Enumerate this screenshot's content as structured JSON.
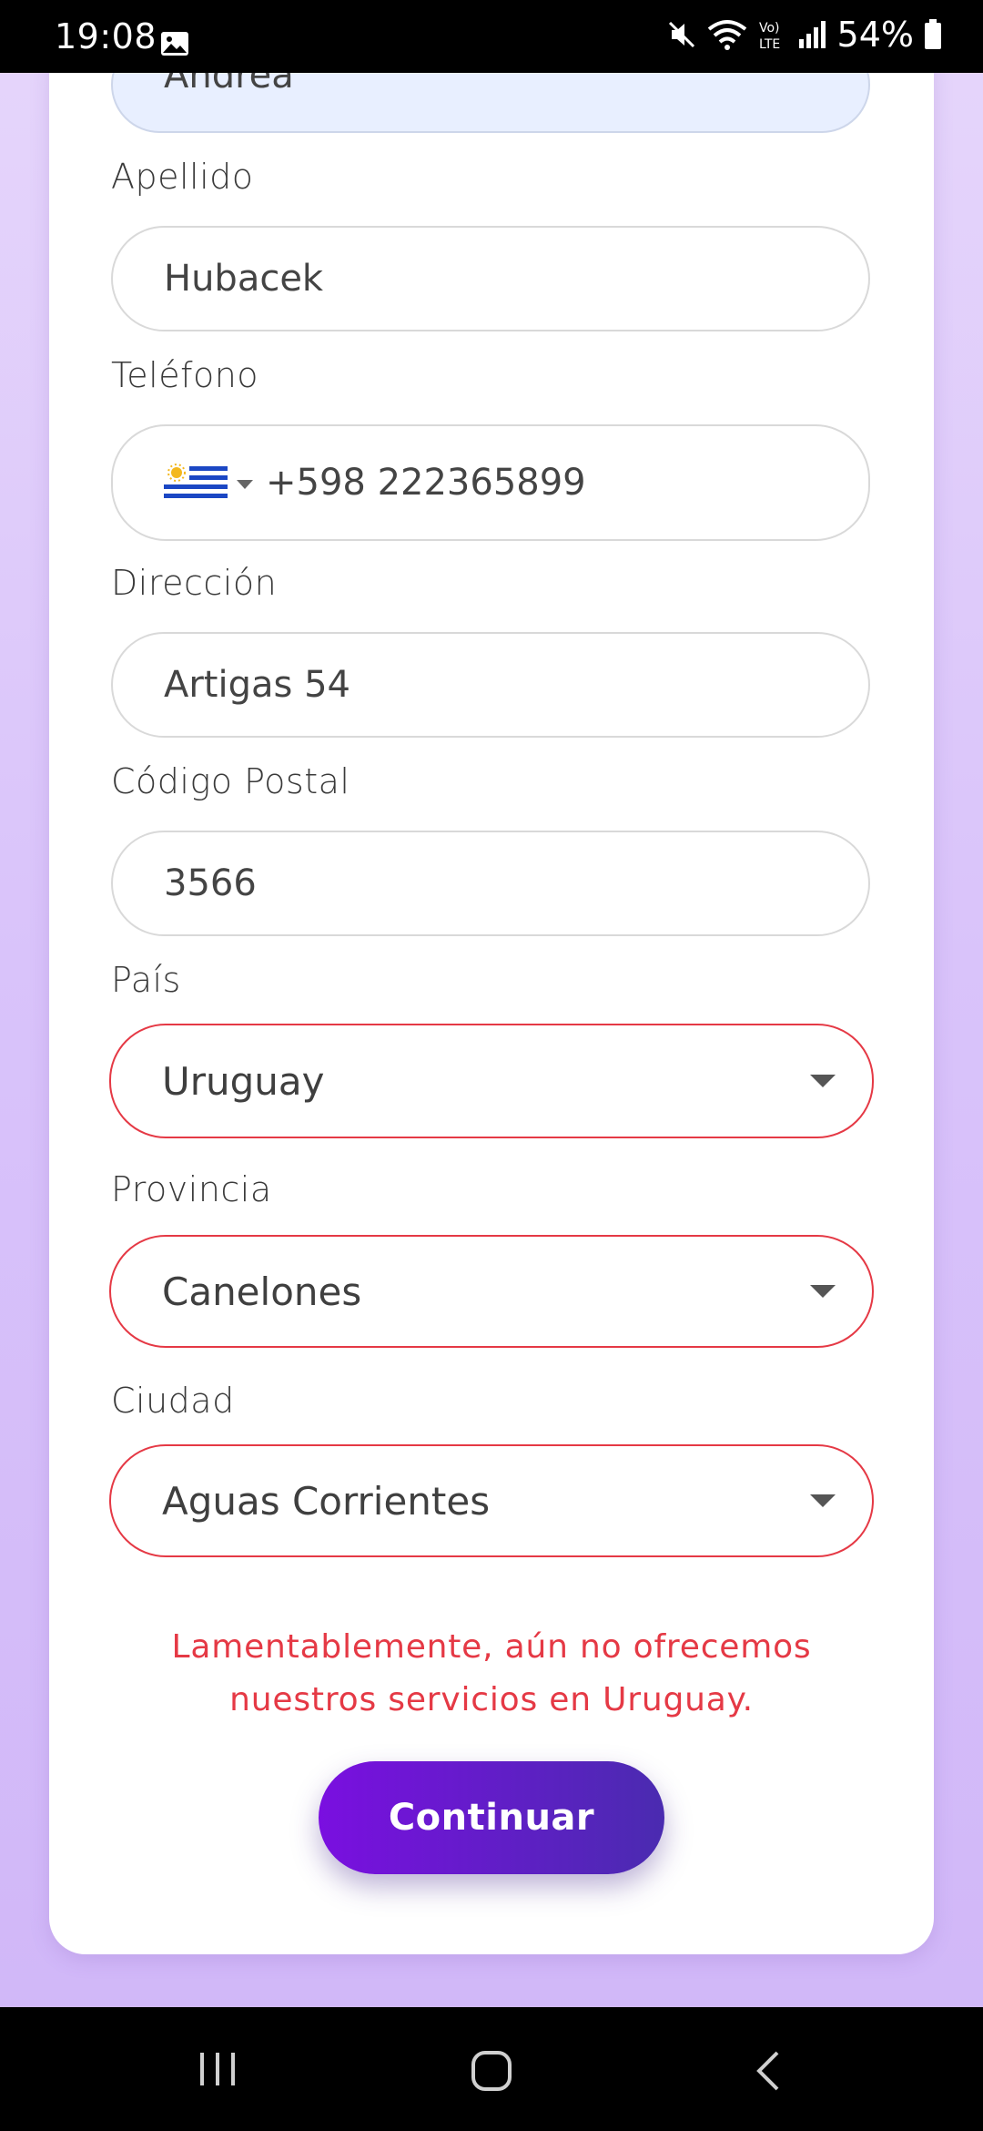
{
  "status_bar": {
    "time": "19:08",
    "battery": "54%",
    "icons": [
      "gallery-icon",
      "mute-icon",
      "wifi-icon",
      "volte-icon",
      "signal-icon",
      "battery-icon"
    ]
  },
  "form": {
    "first_name": {
      "value": "Andrea"
    },
    "last_name": {
      "label": "Apellido",
      "value": "Hubacek"
    },
    "phone": {
      "label": "Teléfono",
      "value": "+598 222365899",
      "flag": "uruguay-flag-icon"
    },
    "address": {
      "label": "Dirección",
      "value": "Artigas 54"
    },
    "postal_code": {
      "label": "Código Postal",
      "value": "3566"
    },
    "country": {
      "label": "País",
      "value": "Uruguay"
    },
    "province": {
      "label": "Provincia",
      "value": "Canelones"
    },
    "city": {
      "label": "Ciudad",
      "value": "Aguas Corrientes"
    }
  },
  "error_message": "Lamentablemente, aún no ofrecemos nuestros servicios en Uruguay.",
  "continue_label": "Continuar",
  "colors": {
    "error": "#e53945",
    "button_start": "#7a0fe0",
    "button_end": "#4a2bb0",
    "background": "#d9c3fa"
  },
  "nav_bar": [
    "recents-icon",
    "home-icon",
    "back-icon"
  ]
}
